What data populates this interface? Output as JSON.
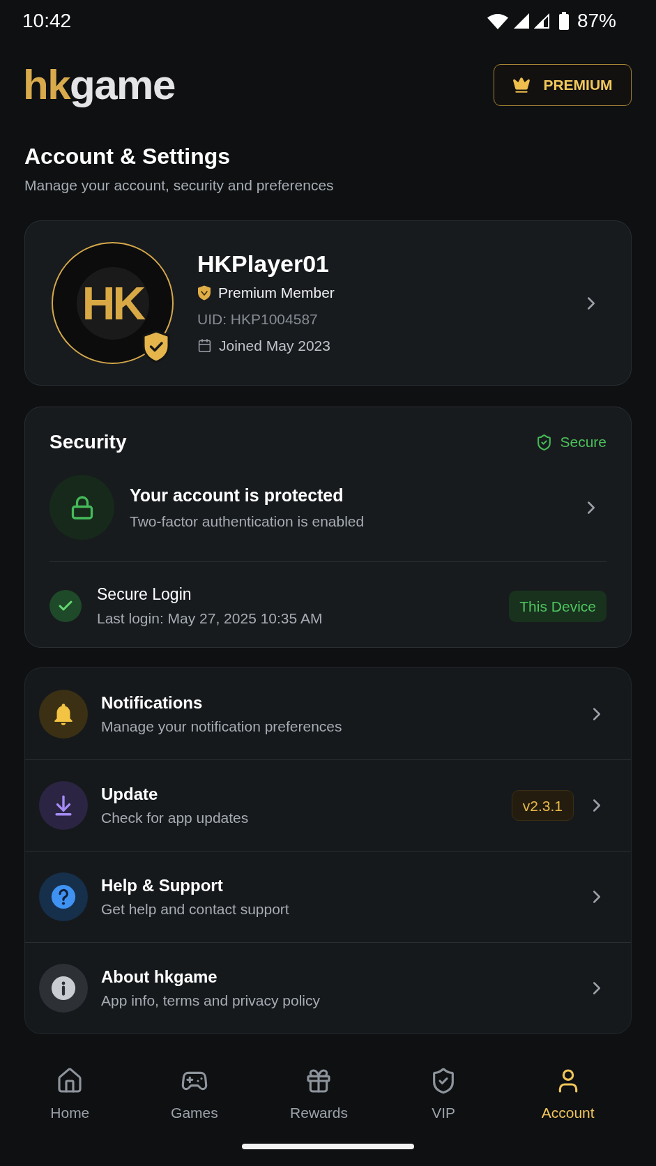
{
  "status_bar": {
    "time": "10:42",
    "battery": "87%"
  },
  "header": {
    "logo": {
      "accent": "hk",
      "rest": "game"
    },
    "premium_button": "PREMIUM"
  },
  "page": {
    "title": "Account & Settings",
    "subtitle": "Manage your account, security and preferences"
  },
  "profile": {
    "avatar_text": "HK",
    "username": "HKPlayer01",
    "membership": "Premium Member",
    "uid": "UID: HKP1004587",
    "joined": "Joined May 2023"
  },
  "security": {
    "title": "Security",
    "status": "Secure",
    "protection": {
      "title": "Your account is protected",
      "subtitle": "Two-factor authentication is enabled"
    },
    "login": {
      "title": "Secure Login",
      "subtitle": "Last login: May 27, 2025 10:35 AM",
      "badge": "This Device"
    }
  },
  "menu": [
    {
      "kind": "notifications",
      "title": "Notifications",
      "subtitle": "Manage your notification preferences"
    },
    {
      "kind": "update",
      "title": "Update",
      "subtitle": "Check for app updates",
      "badge": "v2.3.1"
    },
    {
      "kind": "help",
      "title": "Help & Support",
      "subtitle": "Get help and contact support"
    },
    {
      "kind": "about",
      "title": "About hkgame",
      "subtitle": "App info, terms and privacy policy"
    }
  ],
  "bottom_nav": [
    {
      "kind": "home",
      "label": "Home",
      "selected": false
    },
    {
      "kind": "games",
      "label": "Games",
      "selected": false
    },
    {
      "kind": "rewards",
      "label": "Rewards",
      "selected": false
    },
    {
      "kind": "vip",
      "label": "VIP",
      "selected": false
    },
    {
      "kind": "account",
      "label": "Account",
      "selected": true
    }
  ]
}
